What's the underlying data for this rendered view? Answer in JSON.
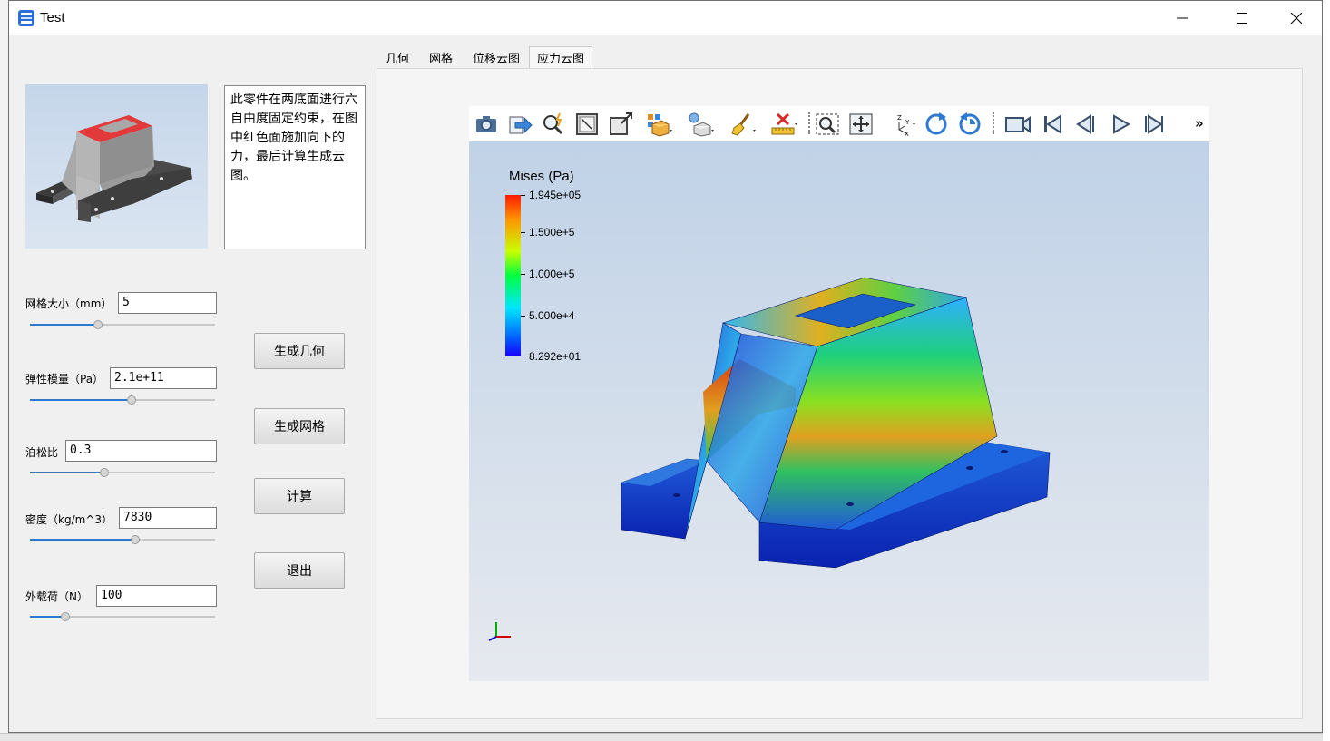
{
  "window": {
    "title": "Test"
  },
  "description": "此零件在两底面进行六自由度固定约束，在图中红色面施加向下的力，最后计算生成云图。",
  "params": [
    {
      "label": "网格大小（mm）",
      "value": "5",
      "slider": 0.37
    },
    {
      "label": "弹性模量（Pa）",
      "value": "2.1e+11",
      "slider": 0.55
    },
    {
      "label": "泊松比",
      "value": "0.3",
      "slider": 0.4
    },
    {
      "label": "密度（kg/m^3）",
      "value": "7830",
      "slider": 0.57
    },
    {
      "label": "外载荷（N）",
      "value": "100",
      "slider": 0.19
    }
  ],
  "buttons": {
    "gen_geometry": "生成几何",
    "gen_mesh": "生成网格",
    "compute": "计算",
    "exit": "退出"
  },
  "tabs": [
    {
      "label": "几何",
      "active": false
    },
    {
      "label": "网格",
      "active": false
    },
    {
      "label": "位移云图",
      "active": false
    },
    {
      "label": "应力云图",
      "active": true
    }
  ],
  "viewer": {
    "toolbar_icons": [
      "screenshot-icon",
      "export-icon",
      "zoom-highlight-icon",
      "fit-view-icon",
      "reset-view-icon",
      "display-mode-icon",
      "lighting-icon",
      "clear-brush-icon",
      "remove-ruler-icon",
      "zoom-box-icon",
      "pan-icon",
      "axes-orientation-icon",
      "rotate-cw-icon",
      "rotate-ccw-icon",
      "camera-icon",
      "first-frame-icon",
      "prev-frame-icon",
      "play-icon",
      "last-frame-icon",
      "more-icon"
    ],
    "more_glyph": "»",
    "colorbar": {
      "title": "Mises (Pa)",
      "labels": [
        "1.945e+05",
        "1.500e+5",
        "1.000e+5",
        "5.000e+4",
        "8.292e+01"
      ],
      "values": [
        194500,
        150000,
        100000,
        50000,
        82.92
      ],
      "colors": [
        "#ff1a00",
        "#ff9400",
        "#c8ff00",
        "#00ff40",
        "#00e6ff",
        "#006cff",
        "#1500ff"
      ]
    }
  }
}
